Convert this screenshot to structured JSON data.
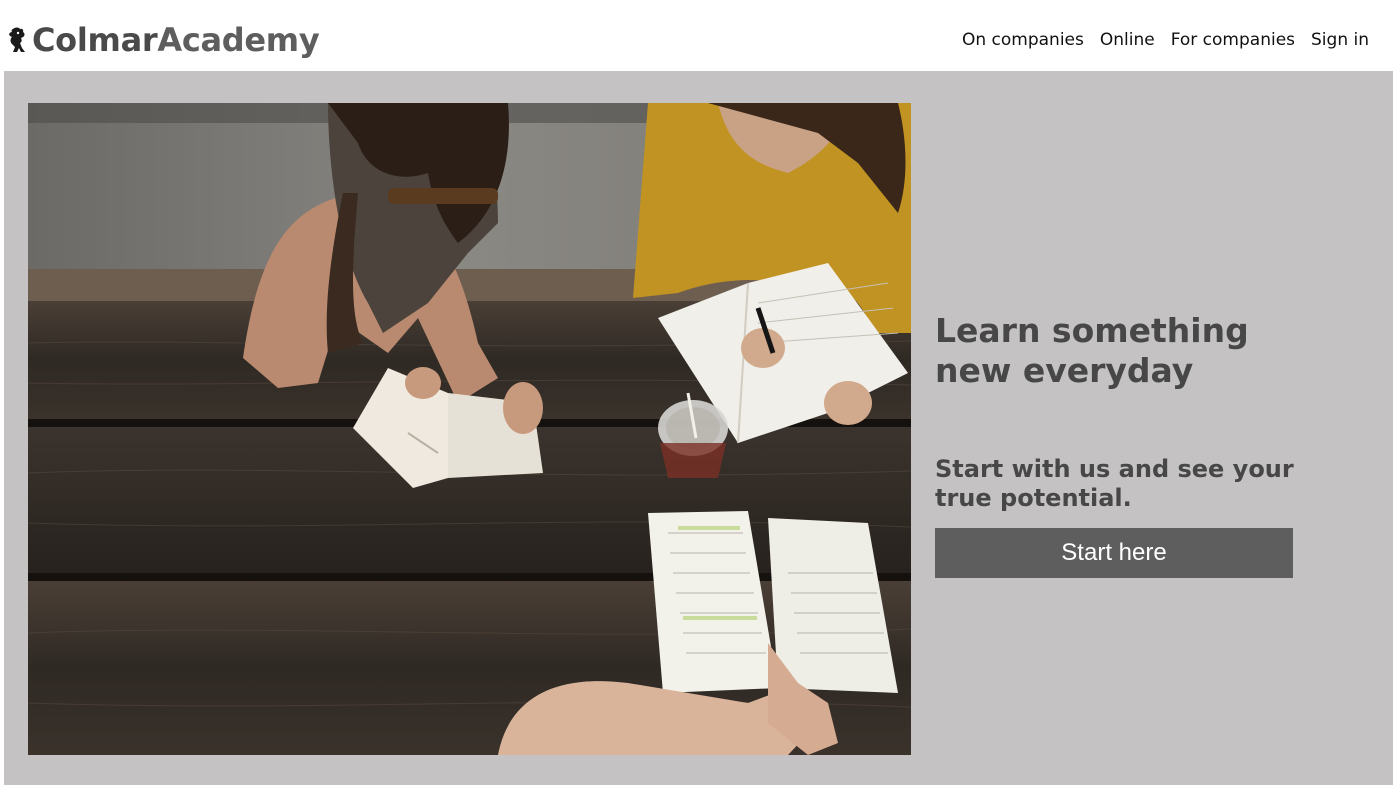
{
  "header": {
    "brand": {
      "part1": "Colmar",
      "part2": "Academy",
      "logo_icon": "lion-icon"
    },
    "nav": [
      {
        "label": "On companies"
      },
      {
        "label": "Online"
      },
      {
        "label": "For companies"
      },
      {
        "label": "Sign in"
      }
    ]
  },
  "hero": {
    "image": {
      "subject": "students-reading-at-picnic-table"
    },
    "headline": "Learn something new everyday",
    "subheadline": "Start with us and see your true potential.",
    "cta_label": "Start here"
  },
  "colors": {
    "hero_background": "#c4c2c3",
    "text_dark": "#474747",
    "button_background": "#5f5e5f",
    "button_text": "#ffffff"
  }
}
